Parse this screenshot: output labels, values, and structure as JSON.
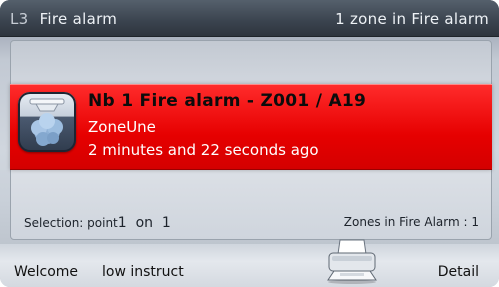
{
  "header": {
    "code": "L3",
    "title": "Fire alarm",
    "status": "1 zone in Fire alarm"
  },
  "alarm": {
    "line1": "Nb 1 Fire alarm - Z001 / A19",
    "zone": "ZoneUne",
    "time": "2 minutes and 22 seconds ago"
  },
  "selection": {
    "label": "Selection: point",
    "value": "1  on  1"
  },
  "zones_summary": "Zones in Fire Alarm : 1",
  "bottom": {
    "welcome": "Welcome",
    "instruct": "low instruct",
    "detail": "Detail"
  },
  "colors": {
    "alarm_red": "#e60000",
    "header_bg": "#3a434e"
  },
  "icons": {
    "alarm": "smoke-detector-icon",
    "print": "printer-icon"
  }
}
